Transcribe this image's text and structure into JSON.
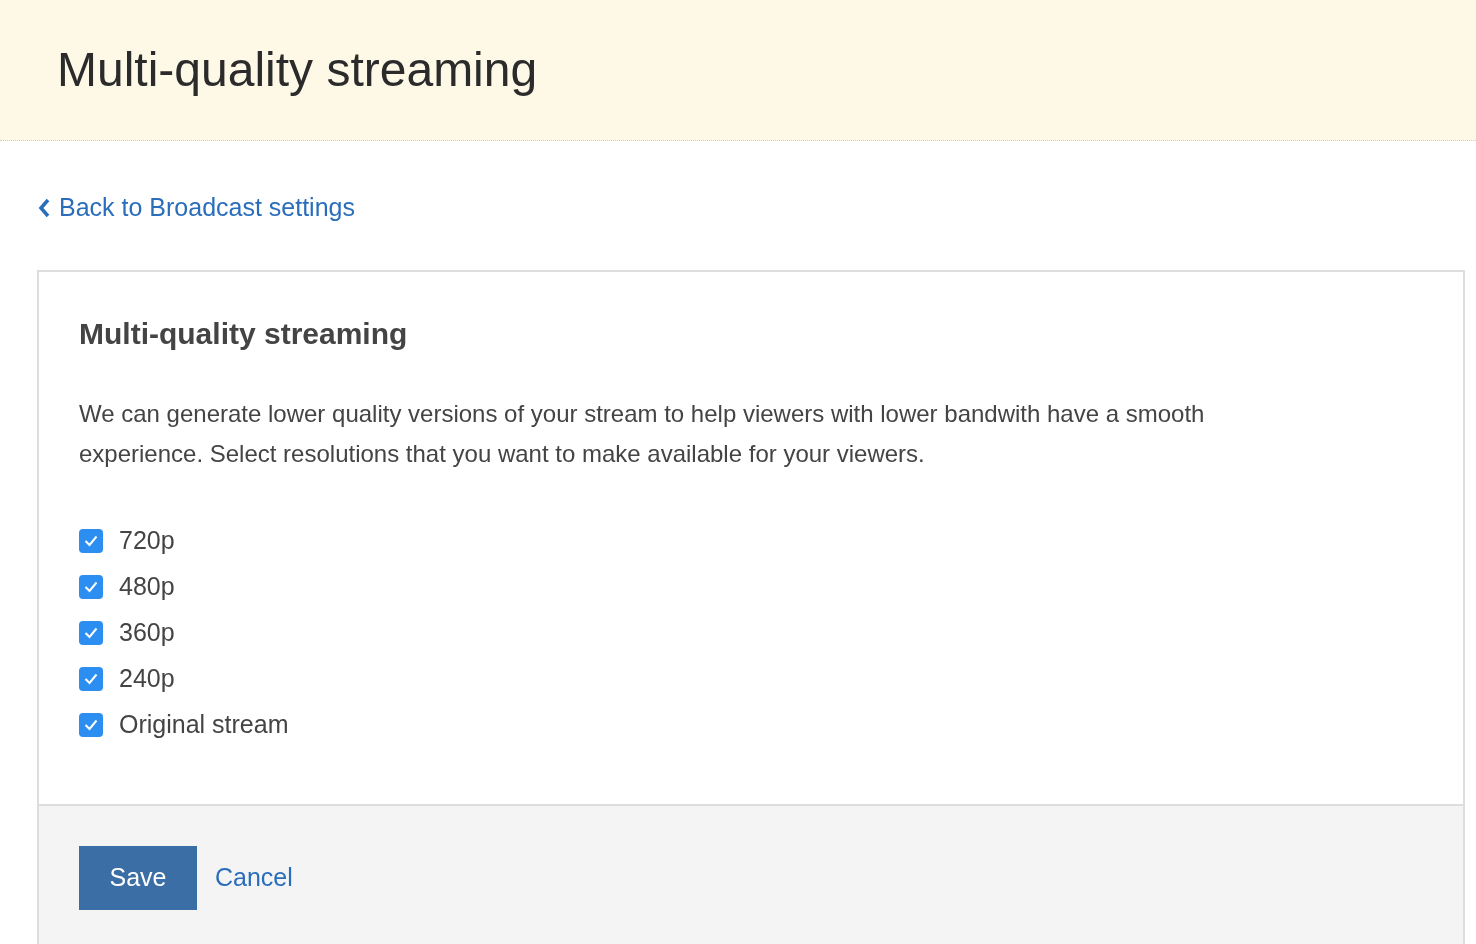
{
  "header": {
    "title": "Multi-quality streaming"
  },
  "back_link": {
    "label": "Back to Broadcast settings"
  },
  "panel": {
    "heading": "Multi-quality streaming",
    "description": "We can generate lower quality versions of your stream to help viewers with lower bandwith have a smooth experience. Select resolutions that you want to make available for your viewers.",
    "options": [
      {
        "label": "720p",
        "checked": true
      },
      {
        "label": "480p",
        "checked": true
      },
      {
        "label": "360p",
        "checked": true
      },
      {
        "label": "240p",
        "checked": true
      },
      {
        "label": "Original stream",
        "checked": true
      }
    ],
    "buttons": {
      "save": "Save",
      "cancel": "Cancel"
    }
  }
}
